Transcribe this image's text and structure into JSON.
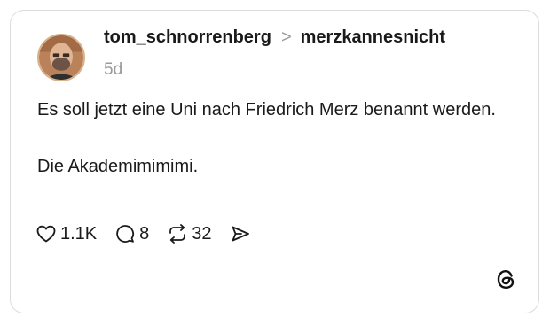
{
  "post": {
    "author": "tom_schnorrenberg",
    "separator": ">",
    "reply_to": "merzkannesnicht",
    "time": "5d",
    "text_line1": "Es soll jetzt eine Uni nach Friedrich Merz benannt werden.",
    "text_line2": "Die Akademimimimi."
  },
  "actions": {
    "likes": "1.1K",
    "replies": "8",
    "reposts": "32"
  },
  "icons": [
    "heart-icon",
    "comment-icon",
    "repost-icon",
    "share-icon",
    "threads-logo-icon"
  ]
}
